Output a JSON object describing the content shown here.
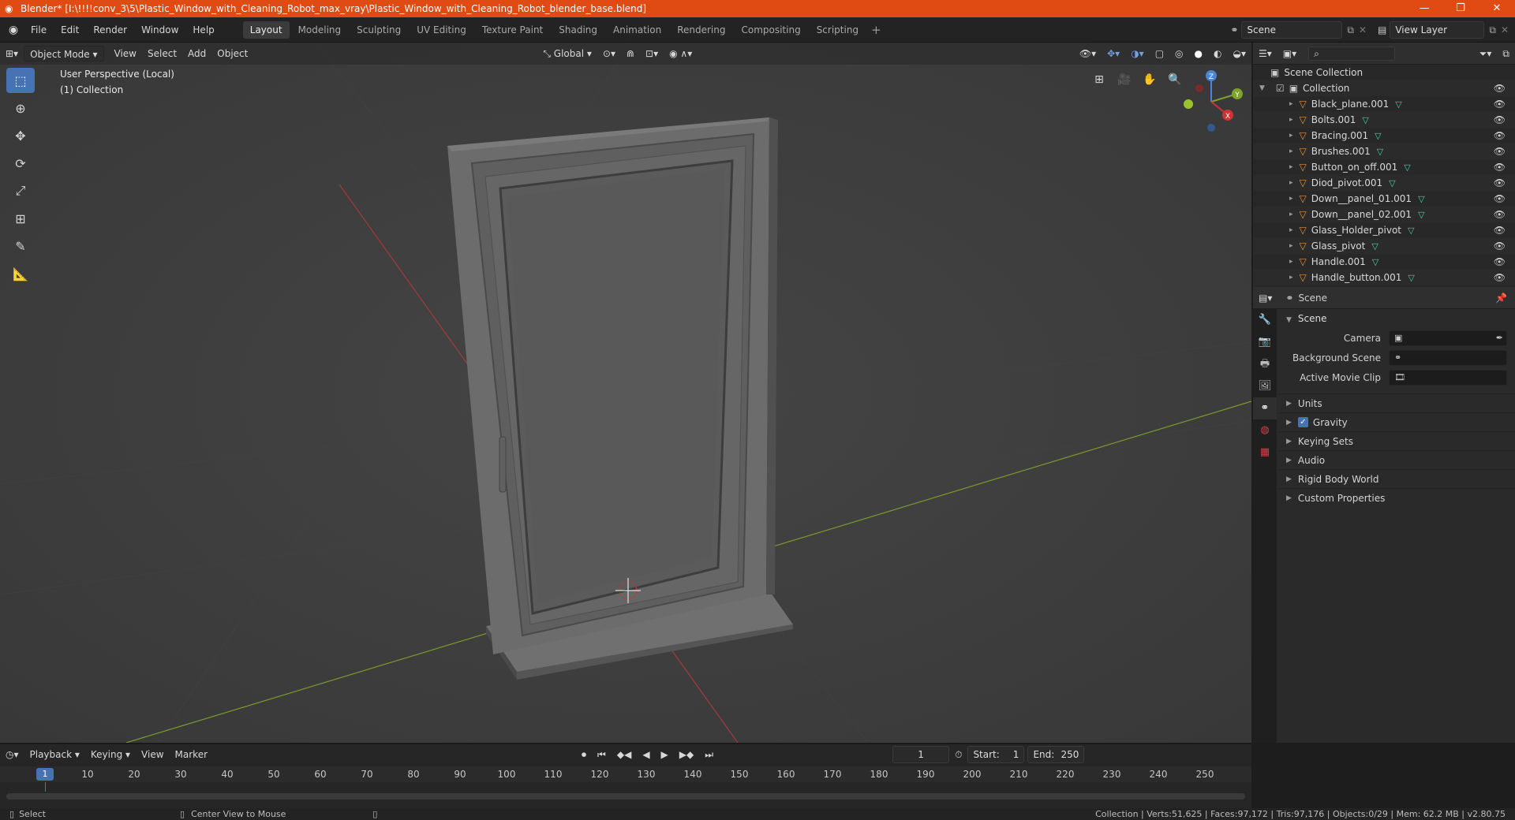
{
  "window": {
    "title": "Blender* [I:\\!!!!conv_3\\5\\Plastic_Window_with_Cleaning_Robot_max_vray\\Plastic_Window_with_Cleaning_Robot_blender_base.blend]",
    "controls": {
      "minimize": "—",
      "maximize": "❐",
      "close": "✕"
    }
  },
  "menubar": {
    "items": [
      "File",
      "Edit",
      "Render",
      "Window",
      "Help"
    ],
    "workspaces": [
      "Layout",
      "Modeling",
      "Sculpting",
      "UV Editing",
      "Texture Paint",
      "Shading",
      "Animation",
      "Rendering",
      "Compositing",
      "Scripting"
    ],
    "active_workspace": "Layout",
    "scene_name": "Scene",
    "view_layer": "View Layer"
  },
  "viewport": {
    "mode": "Object Mode",
    "menus": [
      "View",
      "Select",
      "Add",
      "Object"
    ],
    "orientation": "Global",
    "info_line1": "User Perspective (Local)",
    "info_line2": "(1) Collection",
    "gizmo": {
      "x": "X",
      "y": "Y",
      "z": "Z"
    }
  },
  "outliner": {
    "root": "Scene Collection",
    "collection": "Collection",
    "objects": [
      "Black_plane.001",
      "Bolts.001",
      "Bracing.001",
      "Brushes.001",
      "Button_on_off.001",
      "Diod_pivot.001",
      "Down__panel_01.001",
      "Down__panel_02.001",
      "Glass_Holder_pivot",
      "Glass_pivot",
      "Handle.001",
      "Handle_button.001"
    ]
  },
  "properties": {
    "header": "Scene",
    "panel": "Scene",
    "fields": [
      {
        "label": "Camera",
        "value": ""
      },
      {
        "label": "Background Scene",
        "value": ""
      },
      {
        "label": "Active Movie Clip",
        "value": ""
      }
    ],
    "subpanels": [
      "Units",
      "Gravity",
      "Keying Sets",
      "Audio",
      "Rigid Body World",
      "Custom Properties"
    ],
    "gravity_checked": true
  },
  "timeline": {
    "menus": [
      "Playback",
      "Keying",
      "View",
      "Marker"
    ],
    "current_frame": "1",
    "start_label": "Start:",
    "start": "1",
    "end_label": "End:",
    "end": "250",
    "ticks": [
      "1",
      "10",
      "20",
      "30",
      "40",
      "50",
      "60",
      "70",
      "80",
      "90",
      "100",
      "110",
      "120",
      "130",
      "140",
      "150",
      "160",
      "170",
      "180",
      "190",
      "200",
      "210",
      "220",
      "230",
      "240",
      "250"
    ]
  },
  "statusbar": {
    "left": "Select",
    "middle": "Center View to Mouse",
    "right": "Collection | Verts:51,625 | Faces:97,172 | Tris:97,176 | Objects:0/29 | Mem: 62.2 MB | v2.80.75"
  },
  "colors": {
    "accent": "#4772b3",
    "title_bar": "#df4b13",
    "object_icon": "#e8913a",
    "mesh_icon": "#3fd0a8"
  }
}
